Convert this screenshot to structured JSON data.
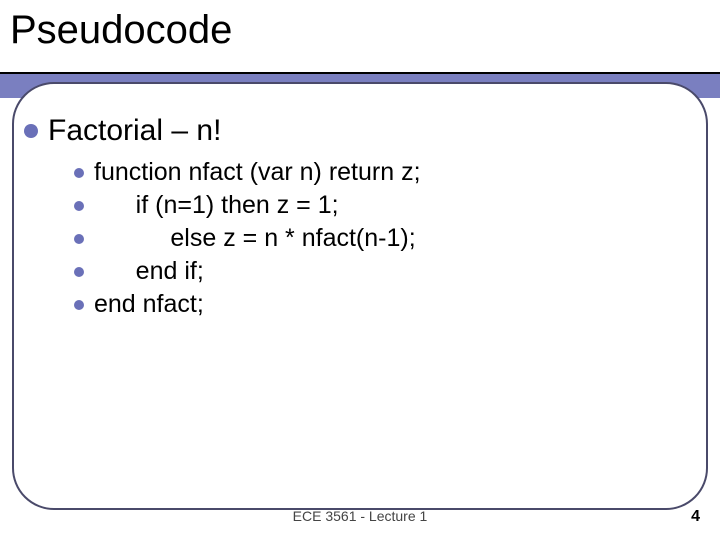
{
  "title": "Pseudocode",
  "heading": "Factorial – n!",
  "lines": [
    "function nfact (var n) return z;",
    "      if (n=1) then z = 1;",
    "           else z = n * nfact(n-1);",
    "      end if;",
    "end nfact;"
  ],
  "footer": "ECE 3561 - Lecture 1",
  "page": "4"
}
